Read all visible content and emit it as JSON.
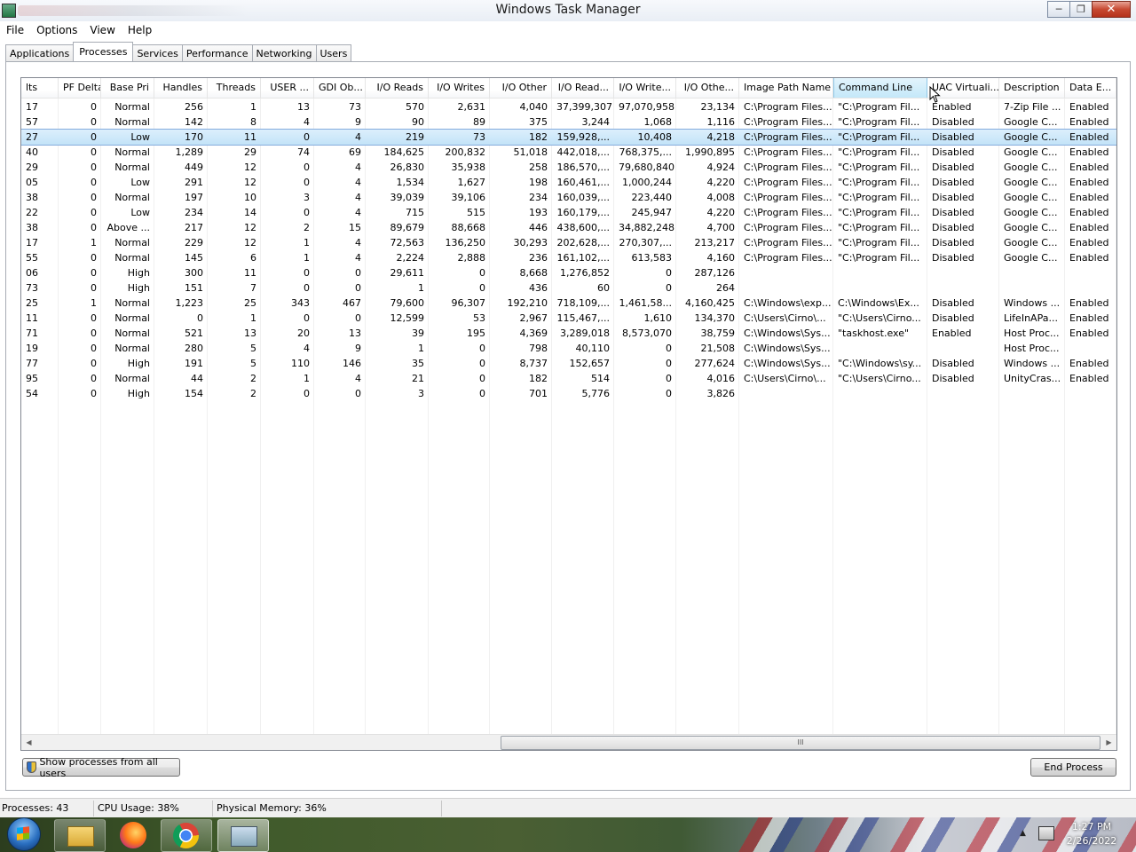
{
  "window": {
    "title": "Windows Task Manager"
  },
  "menu": [
    "File",
    "Options",
    "View",
    "Help"
  ],
  "tabs": [
    {
      "label": "Applications"
    },
    {
      "label": "Processes"
    },
    {
      "label": "Services"
    },
    {
      "label": "Performance"
    },
    {
      "label": "Networking"
    },
    {
      "label": "Users"
    }
  ],
  "active_tab": "Processes",
  "columns": [
    {
      "label": "lts",
      "align": "l"
    },
    {
      "label": "PF Delta",
      "align": "r"
    },
    {
      "label": "Base Pri",
      "align": "r"
    },
    {
      "label": "Handles",
      "align": "r"
    },
    {
      "label": "Threads",
      "align": "r"
    },
    {
      "label": "USER ...",
      "align": "r"
    },
    {
      "label": "GDI Ob...",
      "align": "r"
    },
    {
      "label": "I/O Reads",
      "align": "r"
    },
    {
      "label": "I/O Writes",
      "align": "r"
    },
    {
      "label": "I/O Other",
      "align": "r"
    },
    {
      "label": "I/O Read...",
      "align": "r"
    },
    {
      "label": "I/O Write...",
      "align": "r"
    },
    {
      "label": "I/O Othe...",
      "align": "r"
    },
    {
      "label": "Image Path Name",
      "align": "l"
    },
    {
      "label": "Command Line",
      "align": "l"
    },
    {
      "label": "UAC Virtuali...",
      "align": "l"
    },
    {
      "label": "Description",
      "align": "l"
    },
    {
      "label": "Data E...",
      "align": "l"
    }
  ],
  "hovered_column": "Command Line",
  "rows": [
    [
      "17",
      "0",
      "Normal",
      "256",
      "1",
      "13",
      "73",
      "570",
      "2,631",
      "4,040",
      "37,399,307",
      "97,070,958",
      "23,134",
      "C:\\Program Files...",
      "\"C:\\Program Fil...",
      "Enabled",
      "7-Zip File ...",
      "Enabled"
    ],
    [
      "57",
      "0",
      "Normal",
      "142",
      "8",
      "4",
      "9",
      "90",
      "89",
      "375",
      "3,244",
      "1,068",
      "1,116",
      "C:\\Program Files...",
      "\"C:\\Program Fil...",
      "Disabled",
      "Google C...",
      "Enabled"
    ],
    [
      "27",
      "0",
      "Low",
      "170",
      "11",
      "0",
      "4",
      "219",
      "73",
      "182",
      "159,928,...",
      "10,408",
      "4,218",
      "C:\\Program Files...",
      "\"C:\\Program Fil...",
      "Disabled",
      "Google C...",
      "Enabled"
    ],
    [
      "40",
      "0",
      "Normal",
      "1,289",
      "29",
      "74",
      "69",
      "184,625",
      "200,832",
      "51,018",
      "442,018,...",
      "768,375,...",
      "1,990,895",
      "C:\\Program Files...",
      "\"C:\\Program Fil...",
      "Disabled",
      "Google C...",
      "Enabled"
    ],
    [
      "29",
      "0",
      "Normal",
      "449",
      "12",
      "0",
      "4",
      "26,830",
      "35,938",
      "258",
      "186,570,...",
      "79,680,840",
      "4,924",
      "C:\\Program Files...",
      "\"C:\\Program Fil...",
      "Disabled",
      "Google C...",
      "Enabled"
    ],
    [
      "05",
      "0",
      "Low",
      "291",
      "12",
      "0",
      "4",
      "1,534",
      "1,627",
      "198",
      "160,461,...",
      "1,000,244",
      "4,220",
      "C:\\Program Files...",
      "\"C:\\Program Fil...",
      "Disabled",
      "Google C...",
      "Enabled"
    ],
    [
      "38",
      "0",
      "Normal",
      "197",
      "10",
      "3",
      "4",
      "39,039",
      "39,106",
      "234",
      "160,039,...",
      "223,440",
      "4,008",
      "C:\\Program Files...",
      "\"C:\\Program Fil...",
      "Disabled",
      "Google C...",
      "Enabled"
    ],
    [
      "22",
      "0",
      "Low",
      "234",
      "14",
      "0",
      "4",
      "715",
      "515",
      "193",
      "160,179,...",
      "245,947",
      "4,220",
      "C:\\Program Files...",
      "\"C:\\Program Fil...",
      "Disabled",
      "Google C...",
      "Enabled"
    ],
    [
      "38",
      "0",
      "Above ...",
      "217",
      "12",
      "2",
      "15",
      "89,679",
      "88,668",
      "446",
      "438,600,...",
      "34,882,248",
      "4,700",
      "C:\\Program Files...",
      "\"C:\\Program Fil...",
      "Disabled",
      "Google C...",
      "Enabled"
    ],
    [
      "17",
      "1",
      "Normal",
      "229",
      "12",
      "1",
      "4",
      "72,563",
      "136,250",
      "30,293",
      "202,628,...",
      "270,307,...",
      "213,217",
      "C:\\Program Files...",
      "\"C:\\Program Fil...",
      "Disabled",
      "Google C...",
      "Enabled"
    ],
    [
      "55",
      "0",
      "Normal",
      "145",
      "6",
      "1",
      "4",
      "2,224",
      "2,888",
      "236",
      "161,102,...",
      "613,583",
      "4,160",
      "C:\\Program Files...",
      "\"C:\\Program Fil...",
      "Disabled",
      "Google C...",
      "Enabled"
    ],
    [
      "06",
      "0",
      "High",
      "300",
      "11",
      "0",
      "0",
      "29,611",
      "0",
      "8,668",
      "1,276,852",
      "0",
      "287,126",
      "",
      "",
      "",
      "",
      ""
    ],
    [
      "73",
      "0",
      "High",
      "151",
      "7",
      "0",
      "0",
      "1",
      "0",
      "436",
      "60",
      "0",
      "264",
      "",
      "",
      "",
      "",
      ""
    ],
    [
      "25",
      "1",
      "Normal",
      "1,223",
      "25",
      "343",
      "467",
      "79,600",
      "96,307",
      "192,210",
      "718,109,...",
      "1,461,58...",
      "4,160,425",
      "C:\\Windows\\exp...",
      "C:\\Windows\\Ex...",
      "Disabled",
      "Windows ...",
      "Enabled"
    ],
    [
      "11",
      "0",
      "Normal",
      "0",
      "1",
      "0",
      "0",
      "12,599",
      "53",
      "2,967",
      "115,467,...",
      "1,610",
      "134,370",
      "C:\\Users\\Cirno\\...",
      "\"C:\\Users\\Cirno...",
      "Disabled",
      "LifeInAPa...",
      "Enabled"
    ],
    [
      "71",
      "0",
      "Normal",
      "521",
      "13",
      "20",
      "13",
      "39",
      "195",
      "4,369",
      "3,289,018",
      "8,573,070",
      "38,759",
      "C:\\Windows\\Sys...",
      "\"taskhost.exe\"",
      "Enabled",
      "Host Proc...",
      "Enabled"
    ],
    [
      "19",
      "0",
      "Normal",
      "280",
      "5",
      "4",
      "9",
      "1",
      "0",
      "798",
      "40,110",
      "0",
      "21,508",
      "C:\\Windows\\Sys...",
      "",
      "",
      "Host Proc...",
      ""
    ],
    [
      "77",
      "0",
      "High",
      "191",
      "5",
      "110",
      "146",
      "35",
      "0",
      "8,737",
      "152,657",
      "0",
      "277,624",
      "C:\\Windows\\Sys...",
      "\"C:\\Windows\\sy...",
      "Disabled",
      "Windows ...",
      "Enabled"
    ],
    [
      "95",
      "0",
      "Normal",
      "44",
      "2",
      "1",
      "4",
      "21",
      "0",
      "182",
      "514",
      "0",
      "4,016",
      "C:\\Users\\Cirno\\...",
      "\"C:\\Users\\Cirno...",
      "Disabled",
      "UnityCras...",
      "Enabled"
    ],
    [
      "54",
      "0",
      "High",
      "154",
      "2",
      "0",
      "0",
      "3",
      "0",
      "701",
      "5,776",
      "0",
      "3,826",
      "",
      "",
      "",
      "",
      ""
    ]
  ],
  "selected_row": 2,
  "buttons": {
    "show_all": "Show processes from all users",
    "end_process": "End Process"
  },
  "status": {
    "processes": "Processes: 43",
    "cpu": "CPU Usage: 38%",
    "memory": "Physical Memory: 36%"
  },
  "taskbar": {
    "time": "1:27 PM",
    "date": "2/26/2022"
  },
  "scrollbar": {
    "grip": "III"
  },
  "colors": {
    "selection": "#cde8f8",
    "hover_header": "#d3ecfa",
    "close_button": "#c74a32"
  }
}
